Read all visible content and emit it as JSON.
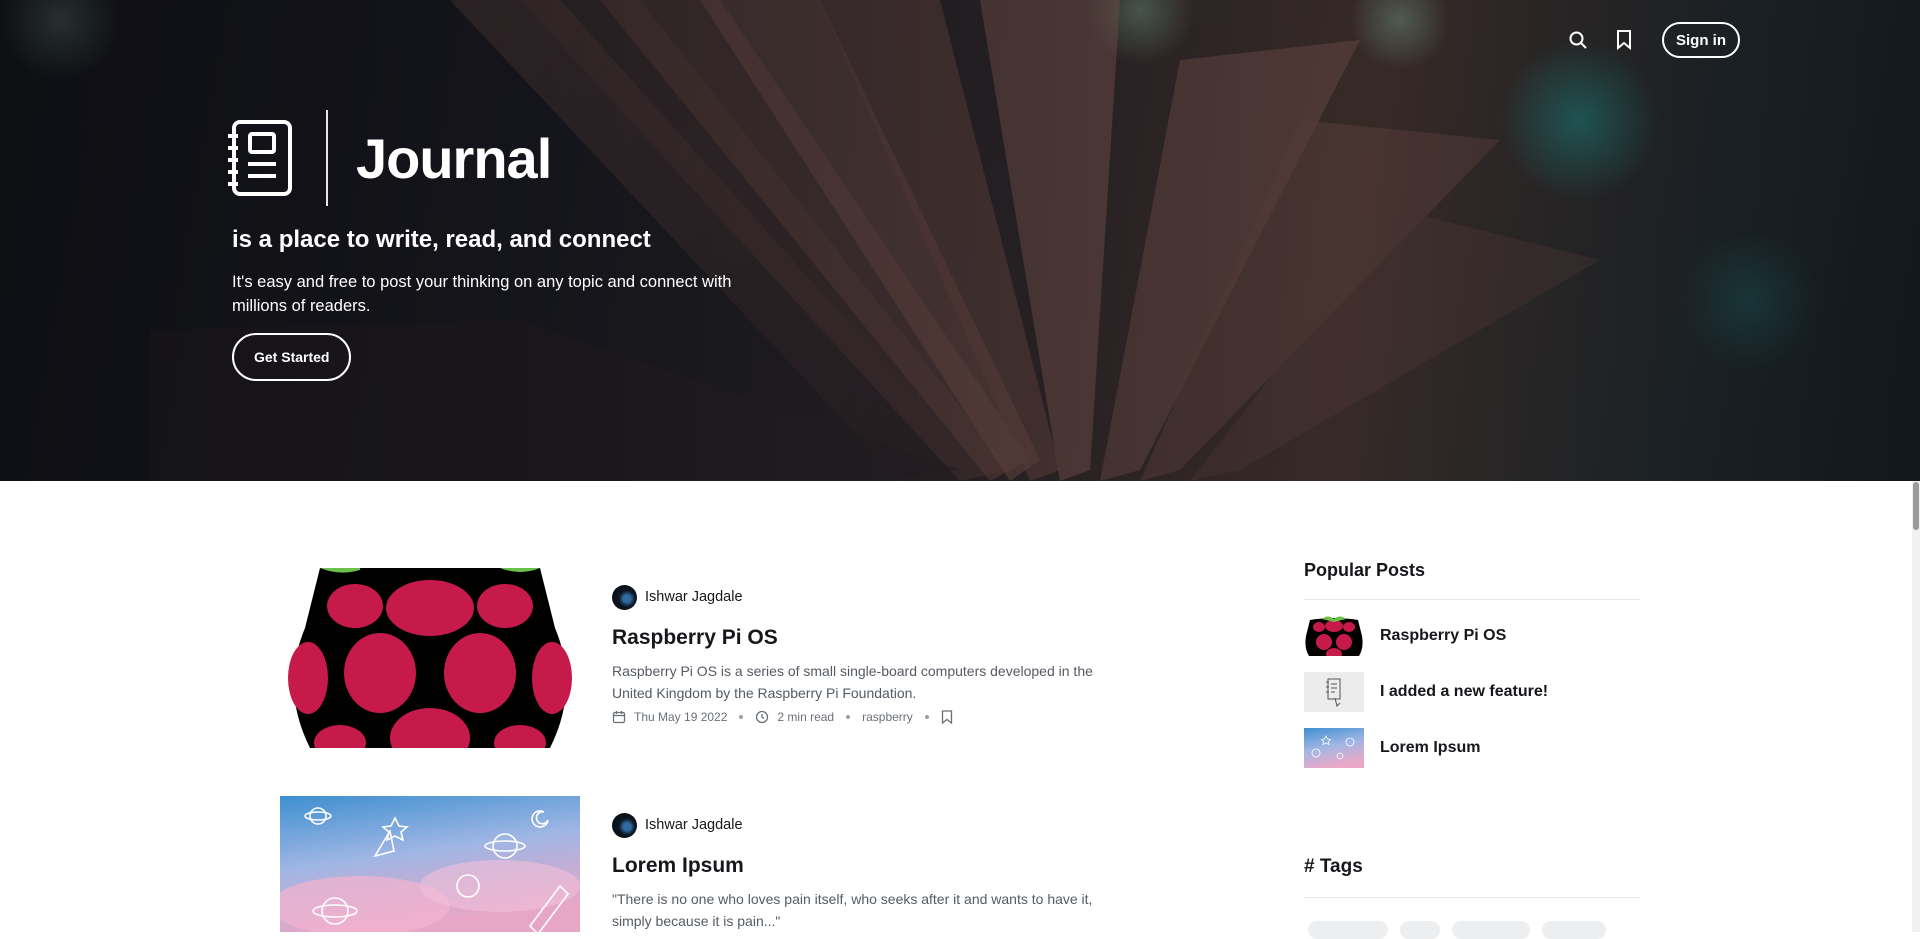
{
  "header": {
    "search_icon": "search-icon",
    "bookmark_icon": "bookmark-icon",
    "signin_label": "Sign in"
  },
  "hero": {
    "brand_name": "Journal",
    "tagline": "is a place to write, read, and connect",
    "subtext": "It's easy and free to post your thinking on any topic and connect with millions of readers.",
    "cta_label": "Get Started"
  },
  "posts": [
    {
      "author": "Ishwar Jagdale",
      "title": "Raspberry Pi OS",
      "excerpt": "Raspberry Pi OS is a series of small single-board computers developed in the United Kingdom by the Raspberry Pi Foundation.",
      "date": "Thu May 19 2022",
      "read_time": "2 min read",
      "tag": "raspberry"
    },
    {
      "author": "Ishwar Jagdale",
      "title": "Lorem Ipsum",
      "excerpt": "\"There is no one who loves pain itself, who seeks after it and wants to have it, simply because it is pain...\""
    }
  ],
  "sidebar": {
    "popular_heading": "Popular Posts",
    "popular": [
      {
        "title": "Raspberry Pi OS"
      },
      {
        "title": "I added a new feature!"
      },
      {
        "title": "Lorem Ipsum"
      }
    ],
    "tags_heading": "# Tags"
  },
  "colors": {
    "accent": "#c51a4a",
    "text": "#15171a",
    "muted": "#555b63"
  }
}
